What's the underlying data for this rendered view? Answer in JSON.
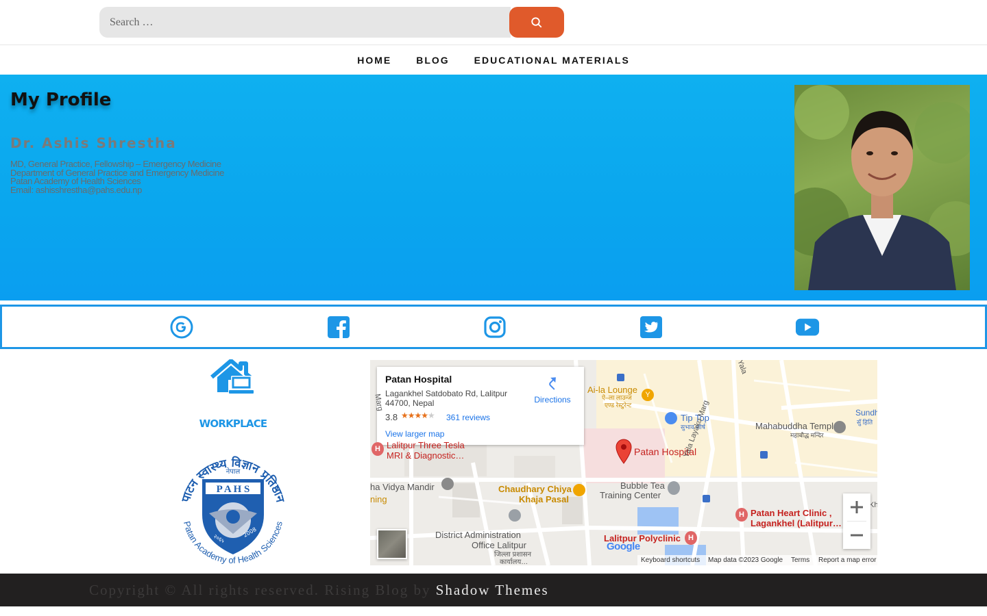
{
  "search": {
    "placeholder": "Search …"
  },
  "nav": {
    "items": [
      {
        "label": "HOME"
      },
      {
        "label": "BLOG"
      },
      {
        "label": "EDUCATIONAL MATERIALS"
      }
    ]
  },
  "hero": {
    "title": "My Profile",
    "name": "Dr. Ashis Shrestha",
    "details": [
      "MD, General Practice, Fellowship – Emergency Medicine",
      "Department of General Practice and Emergency Medicine",
      "Patan Academy of Health Sciences",
      "Email: ashisshrestha@pahs.edu.np"
    ]
  },
  "social": {
    "icons": [
      "google-icon",
      "facebook-icon",
      "instagram-icon",
      "twitter-icon",
      "youtube-icon"
    ],
    "color": "#1d96e6"
  },
  "workplace": {
    "title": "WORKPLACE",
    "logo": {
      "top_text": "पाटन स्वास्थ्य विज्ञान प्रतिष्ठान",
      "nepal": "नेपाल",
      "letters": "P A H S",
      "bottom_text": "Patan Academy of Health Sciences",
      "year1": "२०६५",
      "year2": "2008"
    }
  },
  "map": {
    "card": {
      "place_name": "Patan Hospital",
      "address_line1": "Lagankhel Satdobato Rd, Lalitpur",
      "address_line2": "44700, Nepal",
      "rating": "3.8",
      "stars_filled": 4,
      "reviews": "361 reviews",
      "directions": "Directions",
      "larger_map": "View larger map"
    },
    "labels": {
      "ai_la_lounge": "Ai-la Lounge",
      "ai_la_lounge_np": "ऐ–ला लाउन्ज",
      "ai_la_lounge_np2": "एण्ड रेस्टुरेन्ट",
      "tip_top": "Tip Top",
      "tip_top_np": "सुभाव शीर्ष",
      "mahabuddha": "Mahabuddha Temple",
      "mahabuddha_np": "महाबौद्ध मन्दिर",
      "sundhara": "Sundha",
      "sundhara_np": "सुँ हिति",
      "patan_hospital": "Patan Hospital",
      "three_tesla_1": "Lalitpur Three Tesla",
      "three_tesla_2": "MRI & Diagnostic…",
      "bubble_tea_1": "Bubble Tea",
      "bubble_tea_2": "Training Center",
      "chaudhary_1": "Chaudhary Chiya",
      "chaudhary_2": "Khaja Pasal",
      "vidya_mandir": "ha Vidya Mandir",
      "ning": "ning",
      "district_1": "District Administration",
      "district_2": "Office Lalitpur",
      "district_np1": "जिल्ला प्रशासन",
      "district_np2": "कार्यालय…",
      "heart_1": "Patan Heart Clinic ,",
      "heart_2": "Lagankhel (Lalitpur…",
      "polyclinic": "Lalitpur Polyclinic",
      "yala_layaku": "Yala Layaku Marg",
      "yala": "Yala",
      "marg": "Marg",
      "kh": "Kh"
    },
    "footer": {
      "shortcuts": "Keyboard shortcuts",
      "data": "Map data ©2023 Google",
      "terms": "Terms",
      "report": "Report a map error"
    },
    "google": "Google"
  },
  "footer": {
    "copyright": "Copyright © All rights reserved. Rising Blog by",
    "theme_link": "Shadow Themes"
  }
}
